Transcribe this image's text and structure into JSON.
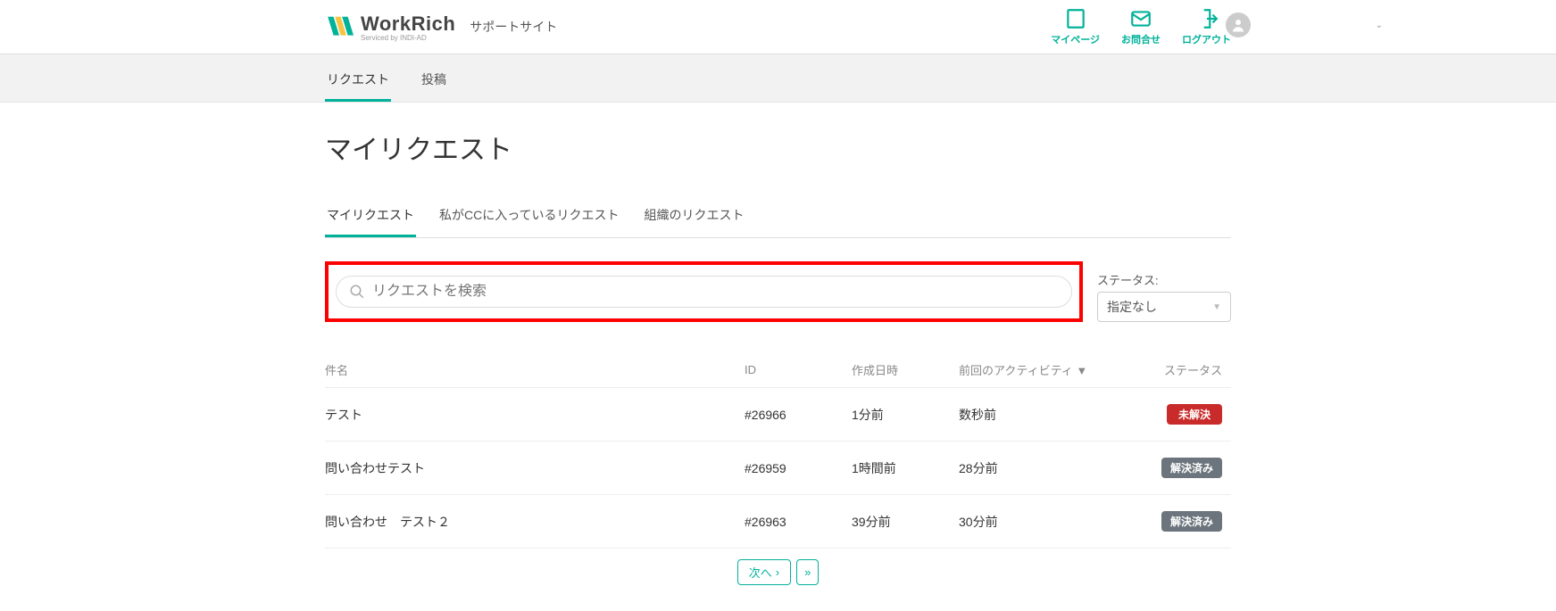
{
  "header": {
    "brand_name": "WorkRich",
    "brand_sub": "Serviced by INDI-AD",
    "site_subtitle": "サポートサイト",
    "actions": {
      "mypage": "マイページ",
      "contact": "お問合せ",
      "logout": "ログアウト"
    }
  },
  "topnav": {
    "request": "リクエスト",
    "post": "投稿"
  },
  "page": {
    "title": "マイリクエスト"
  },
  "subtabs": {
    "my": "マイリクエスト",
    "cc": "私がCCに入っているリクエスト",
    "org": "組織のリクエスト"
  },
  "search": {
    "placeholder": "リクエストを検索"
  },
  "status_filter": {
    "label": "ステータス:",
    "selected": "指定なし"
  },
  "columns": {
    "subject": "件名",
    "id": "ID",
    "created": "作成日時",
    "activity": "前回のアクティビティ ▼",
    "status": "ステータス"
  },
  "rows": [
    {
      "subject": "テスト",
      "id": "#26966",
      "created": "1分前",
      "activity": "数秒前",
      "status": "未解決",
      "status_color": "#c92a2a"
    },
    {
      "subject": "問い合わせテスト",
      "id": "#26959",
      "created": "1時間前",
      "activity": "28分前",
      "status": "解決済み",
      "status_color": "#6c757d"
    },
    {
      "subject": "問い合わせ　テスト２",
      "id": "#26963",
      "created": "39分前",
      "activity": "30分前",
      "status": "解決済み",
      "status_color": "#6c757d"
    }
  ],
  "pager": {
    "next": "次へ"
  }
}
